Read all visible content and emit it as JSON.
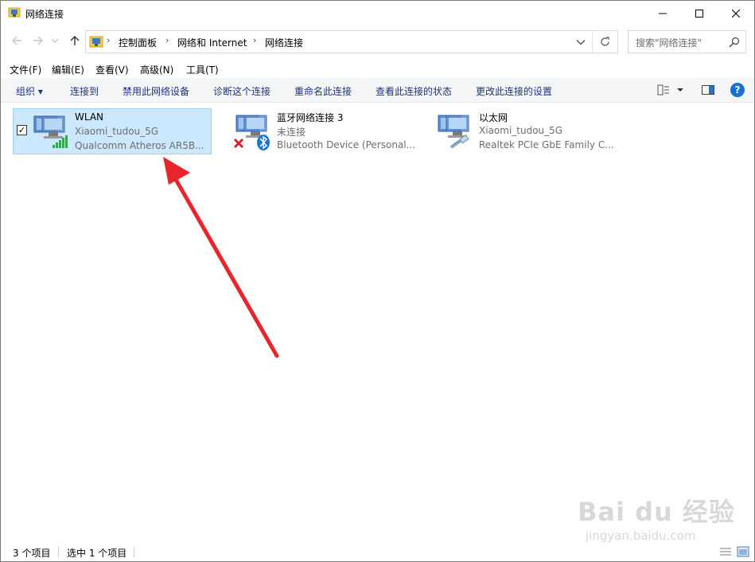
{
  "window": {
    "title": "网络连接",
    "minimize_label": "—",
    "maximize_label": "☐",
    "close_label": "✕"
  },
  "nav": {
    "back_icon": "arrow-left-icon",
    "forward_icon": "arrow-right-icon",
    "recent_icon": "chevron-down-icon",
    "up_icon": "arrow-up-icon"
  },
  "address": {
    "breadcrumbs": [
      "控制面板",
      "网络和 Internet",
      "网络连接"
    ],
    "separator": "›"
  },
  "search": {
    "placeholder": "搜索\"网络连接\""
  },
  "menu": {
    "items": [
      "文件(F)",
      "编辑(E)",
      "查看(V)",
      "高级(N)",
      "工具(T)"
    ]
  },
  "commands": {
    "organize": "组织 ▾",
    "items": [
      "连接到",
      "禁用此网络设备",
      "诊断这个连接",
      "重命名此连接",
      "查看此连接的状态",
      "更改此连接的设置"
    ],
    "help": "?"
  },
  "connections": [
    {
      "name": "WLAN",
      "network": "Xiaomi_tudou_5G",
      "device": "Qualcomm Atheros AR5B...",
      "selected": true,
      "type": "wireless"
    },
    {
      "name": "蓝牙网络连接 3",
      "network": "未连接",
      "device": "Bluetooth Device (Personal...",
      "selected": false,
      "type": "bluetooth"
    },
    {
      "name": "以太网",
      "network": "Xiaomi_tudou_5G",
      "device": "Realtek PCIe GbE Family C...",
      "selected": false,
      "type": "ethernet"
    }
  ],
  "status": {
    "count": "3 个项目",
    "selected": "选中 1 个项目"
  },
  "watermark": {
    "main": "Bai du 经验",
    "sub": "jingyan.baidu.com"
  },
  "colors": {
    "selection_bg": "#cce8ff",
    "selection_border": "#99d1ff",
    "command_text": "#1e3287",
    "arrow": "#e8252b"
  }
}
